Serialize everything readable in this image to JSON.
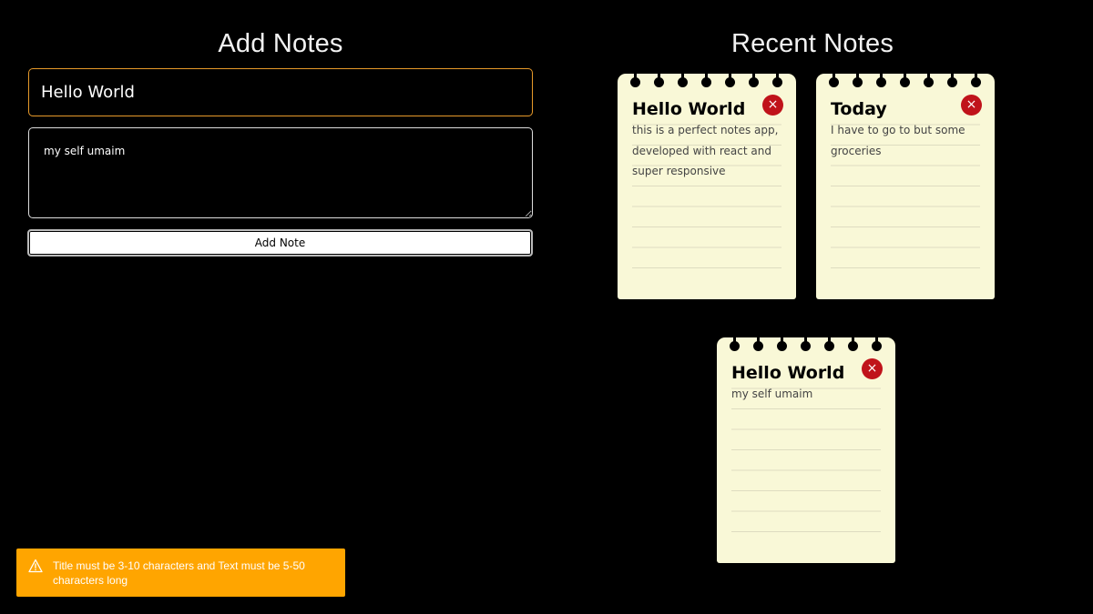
{
  "add_section": {
    "heading": "Add Notes",
    "title_value": "Hello World",
    "text_value": "my self umaim",
    "button_label": "Add Note"
  },
  "recent_section": {
    "heading": "Recent Notes",
    "notes": [
      {
        "title": "Hello World",
        "text": "this is a perfect notes app, developed with react and super responsive"
      },
      {
        "title": "Today",
        "text": "I have to go to but some groceries"
      },
      {
        "title": "Hello World",
        "text": "my self umaim"
      }
    ],
    "delete_icon": "×"
  },
  "toast": {
    "icon": "warning-icon",
    "message": "Title must be 3-10 characters and Text must be 5-50 characters long",
    "color": "#ffa500"
  },
  "colors": {
    "background": "#000000",
    "note_paper": "#f9f8d7",
    "delete_button": "#c0131a",
    "title_input_border": "#e79a2a"
  }
}
